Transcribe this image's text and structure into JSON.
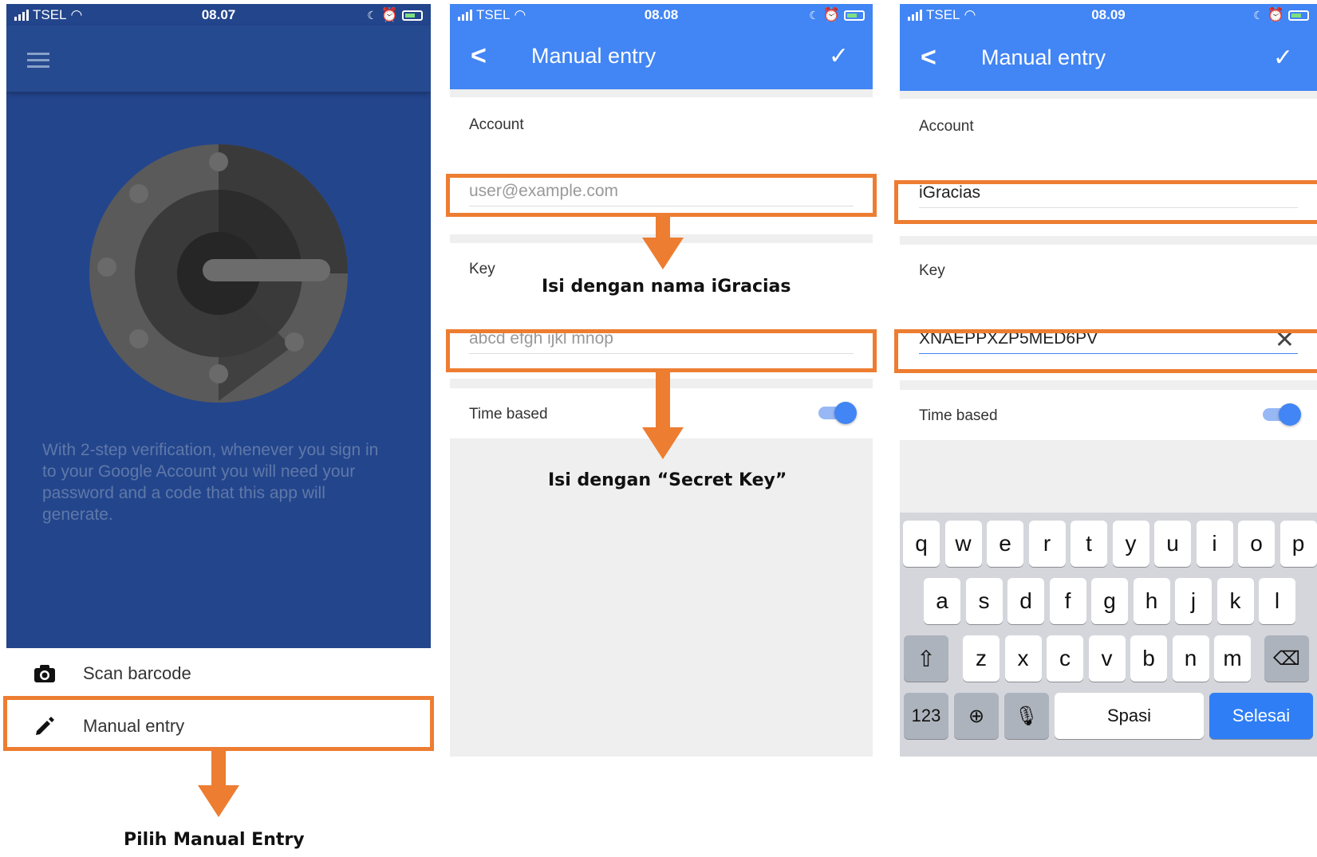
{
  "screen1": {
    "status": {
      "carrier": "TSEL",
      "time": "08.07"
    },
    "intro_text": "With 2-step verification, whenever you sign in to your Google Account you will need your password and a code that this app will generate.",
    "menu": {
      "scan_label": "Scan barcode",
      "manual_label": "Manual entry"
    },
    "annotation": "Pilih Manual Entry"
  },
  "screen2": {
    "status": {
      "carrier": "TSEL",
      "time": "08.08"
    },
    "title": "Manual entry",
    "account_label": "Account",
    "account_placeholder": "user@example.com",
    "key_label": "Key",
    "key_placeholder": "abcd efgh ijkl mnop",
    "time_based_label": "Time based",
    "time_based_on": true,
    "annotation_account": "Isi dengan nama iGracias",
    "annotation_key": "Isi dengan “Secret Key”"
  },
  "screen3": {
    "status": {
      "carrier": "TSEL",
      "time": "08.09"
    },
    "title": "Manual entry",
    "account_label": "Account",
    "account_value": "iGracias",
    "key_label": "Key",
    "key_value": "XNAEPPXZP5MED6PV",
    "time_based_label": "Time based",
    "time_based_on": true,
    "keyboard": {
      "row1": [
        "q",
        "w",
        "e",
        "r",
        "t",
        "y",
        "u",
        "i",
        "o",
        "p"
      ],
      "row2": [
        "a",
        "s",
        "d",
        "f",
        "g",
        "h",
        "j",
        "k",
        "l"
      ],
      "row3": [
        "z",
        "x",
        "c",
        "v",
        "b",
        "n",
        "m"
      ],
      "numbers_label": "123",
      "space_label": "Spasi",
      "done_label": "Selesai"
    }
  },
  "colors": {
    "annotation": "#ed7d31",
    "appbar": "#4285f4",
    "auth_bg": "#23458c"
  }
}
